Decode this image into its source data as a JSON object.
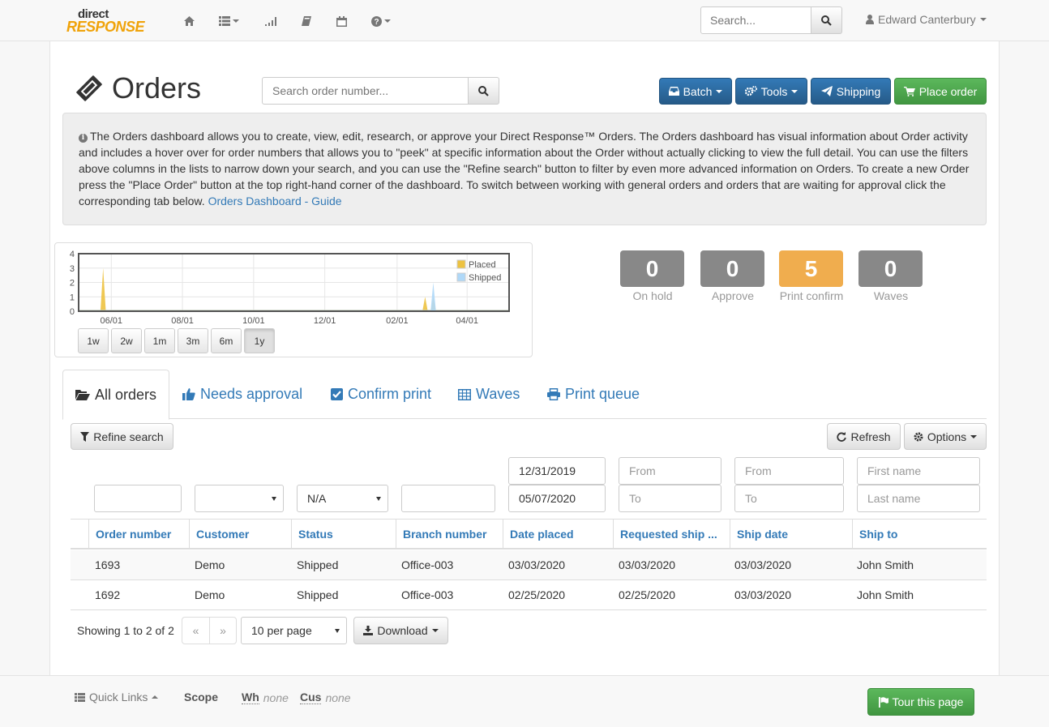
{
  "nav": {
    "brand_top": "direct",
    "brand_bottom": "RESPONSE",
    "search_placeholder": "Search...",
    "user_name": "Edward Canterbury",
    "icons": [
      "home-icon",
      "list-icon",
      "signal-icon",
      "book-icon",
      "calendar-icon",
      "question-icon"
    ]
  },
  "page": {
    "title": "Orders",
    "order_search_placeholder": "Search order number..."
  },
  "actions": {
    "batch": "Batch",
    "tools": "Tools",
    "shipping": "Shipping",
    "place_order": "Place order"
  },
  "info": {
    "text": "The Orders dashboard allows you to create, view, edit, research, or approve your Direct Response™ Orders. The Orders dashboard has visual information about Order activity and includes a hover over for order numbers that allows you to \"peek\" at specific information about the Order without actually clicking to view the full detail. You can use the filters above columns in the lists to narrow down your search, and you can use the \"Refine search\" button to filter by even more advanced information on Orders. To create a new Order press the \"Place Order\" button at the top right-hand corner of the dashboard. To switch between working with general orders and orders that are waiting for approval click the corresponding tab below.",
    "link": "Orders Dashboard - Guide"
  },
  "chart_data": {
    "type": "area",
    "x_ticks": [
      "06/01",
      "08/01",
      "10/01",
      "12/01",
      "02/01",
      "04/01"
    ],
    "y_ticks": [
      "0",
      "1",
      "2",
      "3",
      "4"
    ],
    "ylim": [
      0,
      4
    ],
    "legend_position": "top-right",
    "series": [
      {
        "name": "Placed",
        "color": "#edc240",
        "points": [
          {
            "x": "05/25/2019",
            "y": 3
          },
          {
            "x": "02/25/2020",
            "y": 1
          },
          {
            "x": "03/03/2020",
            "y": 1
          }
        ]
      },
      {
        "name": "Shipped",
        "color": "#afd8f8",
        "points": [
          {
            "x": "03/03/2020",
            "y": 2
          }
        ]
      }
    ],
    "range_buttons": [
      "1w",
      "2w",
      "1m",
      "3m",
      "6m",
      "1y"
    ],
    "active_range": "1y"
  },
  "stats": [
    {
      "value": "0",
      "label": "On hold"
    },
    {
      "value": "0",
      "label": "Approve"
    },
    {
      "value": "5",
      "label": "Print confirm"
    },
    {
      "value": "0",
      "label": "Waves"
    }
  ],
  "tabs": [
    {
      "label": "All orders",
      "icon": "folder-open-icon"
    },
    {
      "label": "Needs approval",
      "icon": "thumbs-up-icon"
    },
    {
      "label": "Confirm print",
      "icon": "check-square-icon"
    },
    {
      "label": "Waves",
      "icon": "table-icon"
    },
    {
      "label": "Print queue",
      "icon": "print-icon"
    }
  ],
  "toolbar": {
    "refine": "Refine search",
    "refresh": "Refresh",
    "options": "Options"
  },
  "filters": {
    "status_value": "N/A",
    "date_from": "12/31/2019",
    "date_to": "05/07/2020",
    "req_from": "From",
    "req_to": "To",
    "ship_from": "From",
    "ship_to": "To",
    "first_name": "First name",
    "last_name": "Last name"
  },
  "table": {
    "columns": [
      "Order number",
      "Customer",
      "Status",
      "Branch number",
      "Date placed",
      "Requested ship ...",
      "Ship date",
      "Ship to"
    ],
    "rows": [
      [
        "1693",
        "Demo",
        "Shipped",
        "Office-003",
        "03/03/2020",
        "03/03/2020",
        "03/03/2020",
        "John Smith"
      ],
      [
        "1692",
        "Demo",
        "Shipped",
        "Office-003",
        "02/25/2020",
        "02/25/2020",
        "03/03/2020",
        "John Smith"
      ]
    ]
  },
  "pagination": {
    "showing": "Showing 1 to 2 of 2",
    "prev": "«",
    "next": "»",
    "per_page": "10 per page",
    "download": "Download"
  },
  "footer": {
    "quick_links": "Quick Links",
    "scope": "Scope",
    "wh_label": "Wh",
    "wh_value": "none",
    "cus_label": "Cus",
    "cus_value": "none",
    "tour": "Tour this page"
  }
}
